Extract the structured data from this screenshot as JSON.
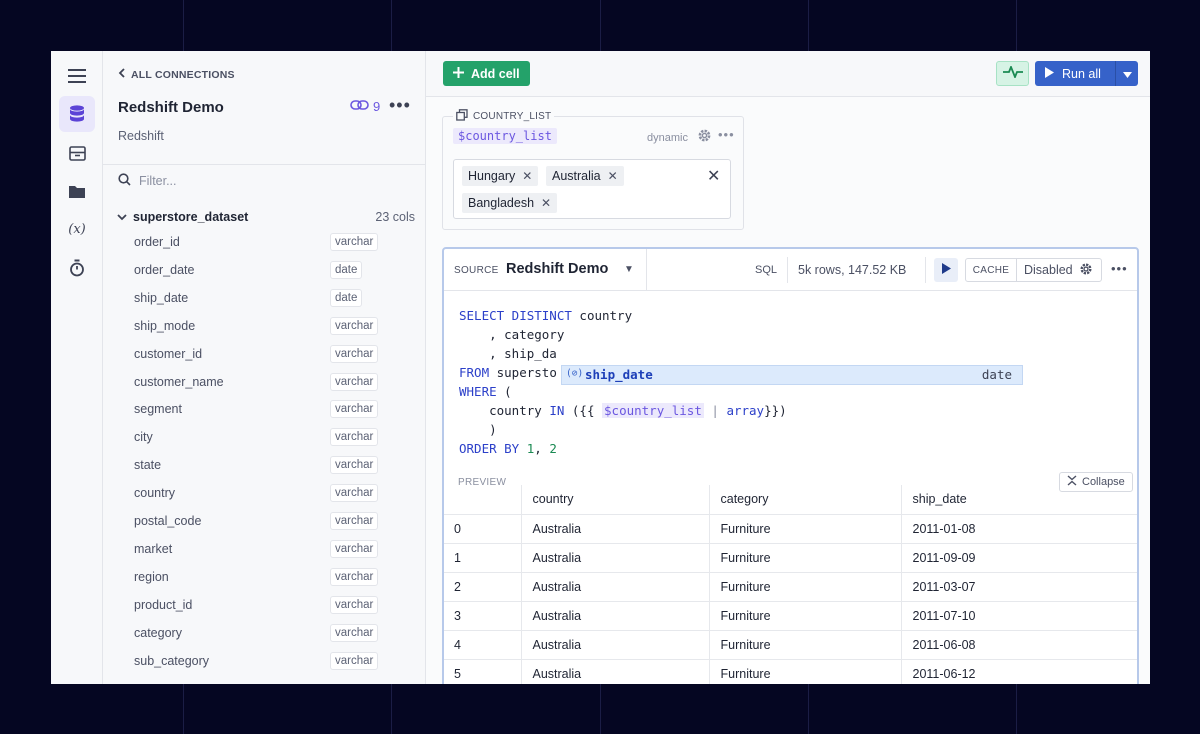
{
  "schema_panel": {
    "back_label": "ALL CONNECTIONS",
    "connection_name": "Redshift Demo",
    "connection_type": "Redshift",
    "link_count": "9",
    "filter_placeholder": "Filter...",
    "dataset": {
      "name": "superstore_dataset",
      "col_count": "23 cols",
      "columns": [
        {
          "name": "order_id",
          "type": "varchar"
        },
        {
          "name": "order_date",
          "type": "date"
        },
        {
          "name": "ship_date",
          "type": "date"
        },
        {
          "name": "ship_mode",
          "type": "varchar"
        },
        {
          "name": "customer_id",
          "type": "varchar"
        },
        {
          "name": "customer_name",
          "type": "varchar"
        },
        {
          "name": "segment",
          "type": "varchar"
        },
        {
          "name": "city",
          "type": "varchar"
        },
        {
          "name": "state",
          "type": "varchar"
        },
        {
          "name": "country",
          "type": "varchar"
        },
        {
          "name": "postal_code",
          "type": "varchar"
        },
        {
          "name": "market",
          "type": "varchar"
        },
        {
          "name": "region",
          "type": "varchar"
        },
        {
          "name": "product_id",
          "type": "varchar"
        },
        {
          "name": "category",
          "type": "varchar"
        },
        {
          "name": "sub_category",
          "type": "varchar"
        }
      ]
    }
  },
  "toolbar": {
    "add_cell_label": "Add cell",
    "run_all_label": "Run all"
  },
  "input_cell": {
    "label": "COUNTRY_LIST",
    "variable": "$country_list",
    "mode": "dynamic",
    "chips": [
      "Hungary",
      "Australia",
      "Bangladesh"
    ]
  },
  "sql_cell": {
    "source_label": "SOURCE",
    "source_name": "Redshift Demo",
    "lang": "SQL",
    "rows_info": "5k rows, 147.52 KB",
    "cache_label": "CACHE",
    "cache_value": "Disabled",
    "code": {
      "l1_kw": "SELECT DISTINCT",
      "l1_rest": " country",
      "l2": "    , category",
      "l3": "    , ship_da",
      "l4_kw": "FROM",
      "l4_rest": " supersto",
      "l5_kw": "WHERE",
      "l5_rest": " (",
      "l6_a": "    country ",
      "l6_kw": "IN",
      "l6_b": " ({{ ",
      "l6_var": "$country_list",
      "l6_pipe": " | ",
      "l6_filter": "array",
      "l6_c": "}})",
      "l7": "    )",
      "l8_kw": "ORDER BY",
      "l8_n1": "1",
      "l8_sep": ", ",
      "l8_n2": "2"
    },
    "autocomplete": {
      "icon": "(⊘)",
      "text": "ship_date",
      "type": "date"
    },
    "preview_label": "PREVIEW",
    "collapse_label": "Collapse",
    "table": {
      "headers": [
        "country",
        "category",
        "ship_date"
      ],
      "rows": [
        [
          "0",
          "Australia",
          "Furniture",
          "2011-01-08"
        ],
        [
          "1",
          "Australia",
          "Furniture",
          "2011-09-09"
        ],
        [
          "2",
          "Australia",
          "Furniture",
          "2011-03-07"
        ],
        [
          "3",
          "Australia",
          "Furniture",
          "2011-07-10"
        ],
        [
          "4",
          "Australia",
          "Furniture",
          "2011-06-08"
        ],
        [
          "5",
          "Australia",
          "Furniture",
          "2011-06-12"
        ]
      ]
    }
  }
}
